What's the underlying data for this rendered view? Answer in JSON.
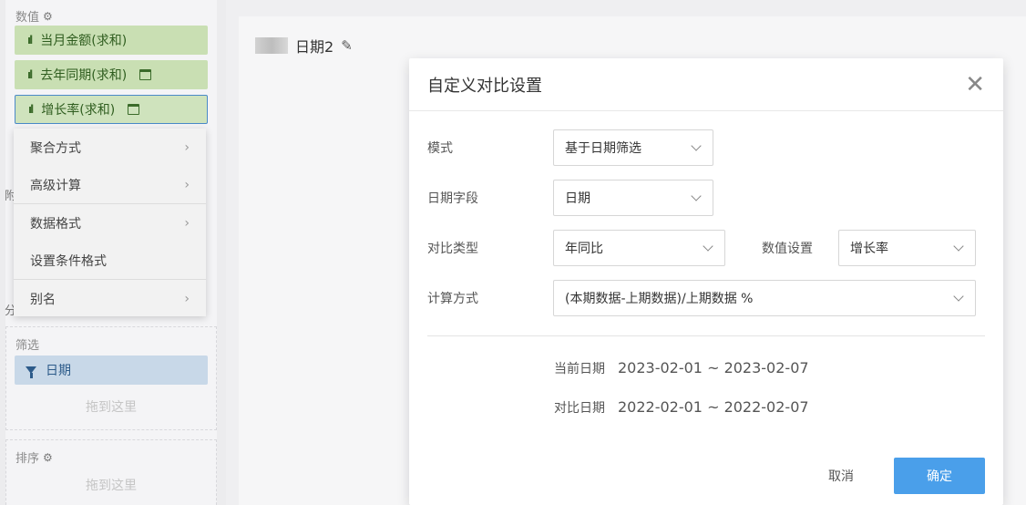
{
  "left": {
    "values_title": "数值",
    "measures": [
      {
        "label": "当月金额(求和)"
      },
      {
        "label": "去年同期(求和)"
      },
      {
        "label": "增长率(求和)"
      }
    ],
    "context_menu": [
      {
        "label": "聚合方式",
        "submenu": true
      },
      {
        "label": "高级计算",
        "submenu": true
      },
      {
        "label": "数据格式",
        "submenu": true
      },
      {
        "label": "设置条件格式",
        "submenu": false
      },
      {
        "label": "别名",
        "submenu": true
      }
    ],
    "side_letter_1": "附",
    "side_letter_2": "分",
    "filter_title": "筛选",
    "filter_item": "日期",
    "drop_hint": "拖到这里",
    "sort_title": "排序"
  },
  "chart": {
    "title": "日期2"
  },
  "dialog": {
    "title": "自定义对比设置",
    "mode_label": "模式",
    "mode_value": "基于日期筛选",
    "date_field_label": "日期字段",
    "date_field_value": "日期",
    "compare_type_label": "对比类型",
    "compare_type_value": "年同比",
    "value_setting_label": "数值设置",
    "value_setting_value": "增长率",
    "calc_label": "计算方式",
    "calc_value": "(本期数据-上期数据)/上期数据 %",
    "current_date_label": "当前日期",
    "current_date_value": "2023-02-01 ~ 2023-02-07",
    "compare_date_label": "对比日期",
    "compare_date_value": "2022-02-01 ~ 2022-02-07",
    "cancel_label": "取消",
    "ok_label": "确定"
  },
  "colors": {
    "accent": "#4a9fea",
    "measure_pill": "#c9dfb3",
    "filter_pill": "#c8d8e8"
  }
}
